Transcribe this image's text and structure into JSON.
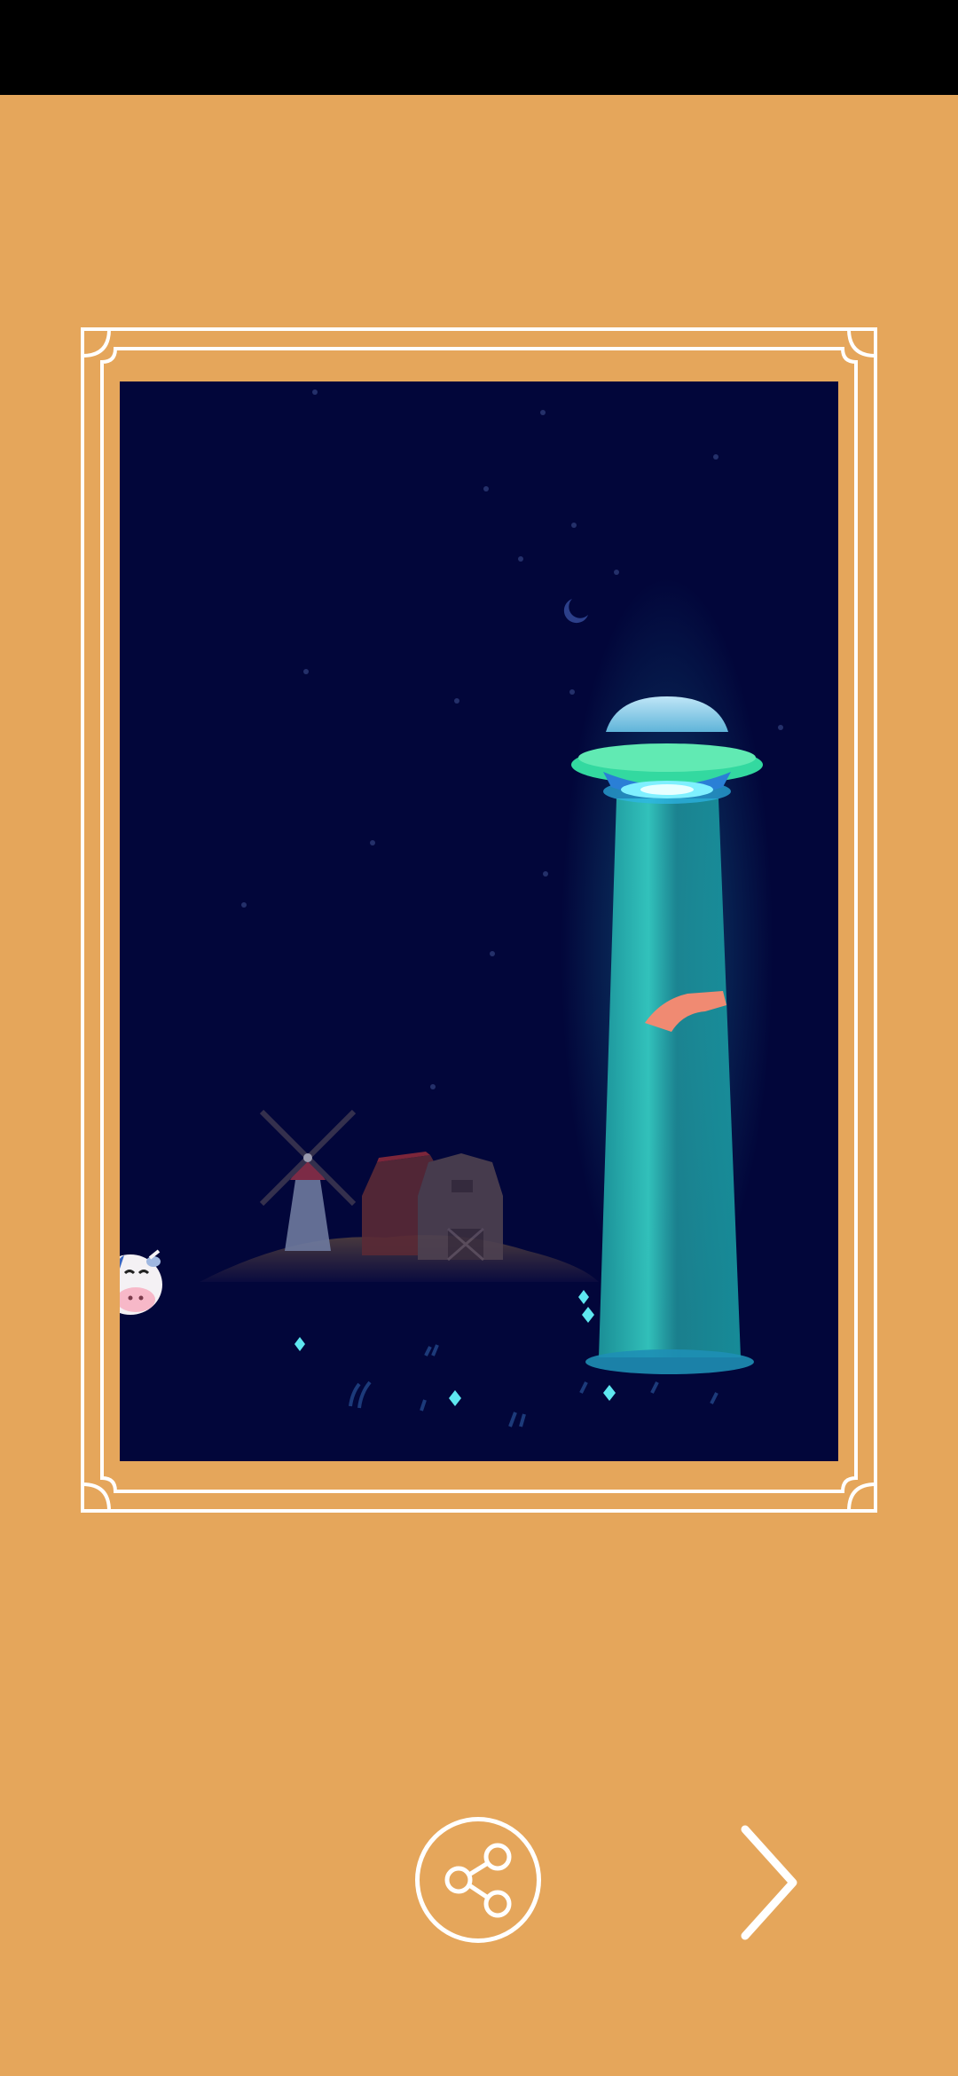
{
  "screen": {
    "background_color": "#E5A65B",
    "status_bar_color": "#000000"
  },
  "game_scene": {
    "sky_color": "#02063A",
    "elements": [
      "crescent-moon",
      "stars",
      "ufo",
      "tractor-beam",
      "abducted-object",
      "windmill",
      "barn",
      "hill",
      "cow",
      "grass",
      "sparkle-flowers"
    ]
  },
  "controls": {
    "share_icon": "share-icon",
    "next_icon": "chevron-right-icon"
  }
}
